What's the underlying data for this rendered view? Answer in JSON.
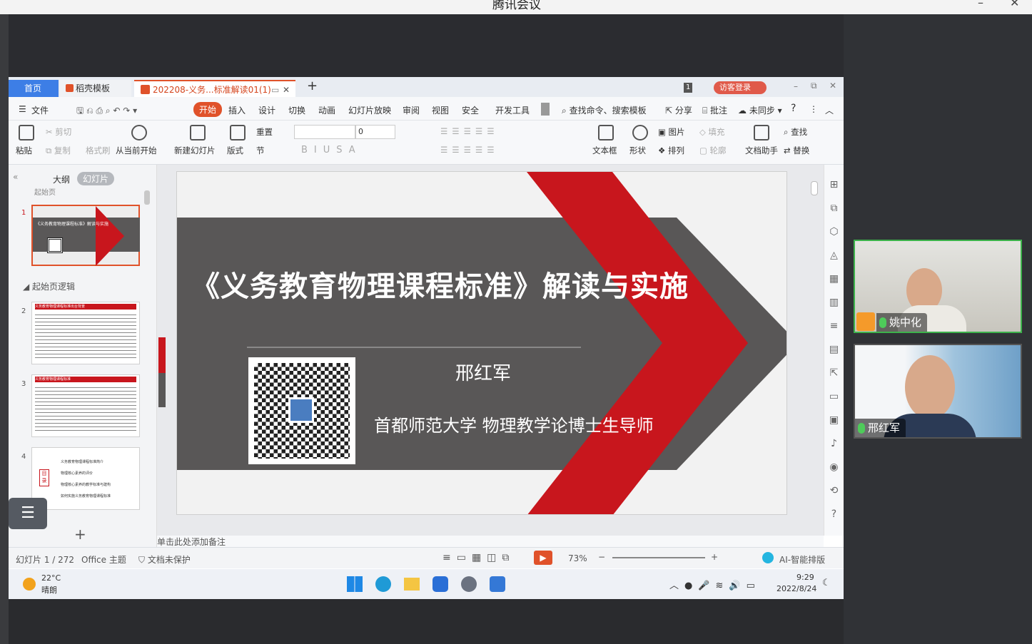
{
  "meeting": {
    "title": "腾讯会议",
    "min": "–",
    "close": "✕"
  },
  "tabs": [
    {
      "label": "首页"
    },
    {
      "label": "稻壳模板"
    },
    {
      "label": "202208-义务...标准解读01(1)"
    }
  ],
  "tab_add": "+",
  "header_right": {
    "slide_badge": "1",
    "guest_login": "访客登录"
  },
  "menu": {
    "file": "文件",
    "items": [
      "开始",
      "插入",
      "设计",
      "切换",
      "动画",
      "幻灯片放映",
      "审阅",
      "视图",
      "安全",
      "开发工具"
    ],
    "search": "查找命令、搜索模板",
    "share": "分享",
    "comment": "批注",
    "sync": "未同步",
    "help": "?"
  },
  "ribbon": {
    "paste": "粘贴",
    "cut": "剪切",
    "copy": "复制",
    "format_painter": "格式刷",
    "from_current": "从当前开始",
    "new_slide": "新建幻灯片",
    "layout": "版式",
    "reset": "重置",
    "section": "节",
    "font_size": "0",
    "textbox": "文本框",
    "shape": "形状",
    "image": "图片",
    "fill": "填充",
    "arrange": "排列",
    "outline": "轮廓",
    "doc_helper": "文档助手",
    "find": "查找",
    "replace": "替换"
  },
  "leftpane": {
    "tab_outline": "大纲",
    "tab_slides": "幻灯片",
    "section_top": "起始页",
    "section": "起始页逻辑",
    "add": "+"
  },
  "thumbs": [
    {
      "num": "1",
      "title": "《义务教育物理课程标准》解读与实施"
    },
    {
      "num": "2",
      "title": "义务教育物理课程标准出台背景"
    },
    {
      "num": "3",
      "title": "义务教育物理课程标准"
    },
    {
      "num": "4",
      "items": [
        "义务教育物理课程标准简介",
        "物理核心素养的评价",
        "物理核心素养的教学标准与建构",
        "如何实施义务教育物理课程标准"
      ],
      "label": "目录"
    }
  ],
  "slide": {
    "title": "《义务教育物理课程标准》解读与实施",
    "author": "邢红军",
    "affiliation": "首都师范大学  物理教学论博士生导师"
  },
  "notes": "单击此处添加备注",
  "status": {
    "slide_count": "幻灯片 1 / 272",
    "theme": "Office 主题",
    "protect": "文档未保护",
    "zoom": "73%",
    "ai": "AI-智能排版"
  },
  "taskbar": {
    "temp": "22°C",
    "weather": "晴朗",
    "time": "9:29",
    "date": "2022/8/24"
  },
  "participants": [
    {
      "name": "姚中化"
    },
    {
      "name": "邢红军"
    }
  ],
  "colors": {
    "accent": "#e0522a",
    "red": "#c8161d",
    "gray": "#595757",
    "active_green": "#3db24b"
  }
}
